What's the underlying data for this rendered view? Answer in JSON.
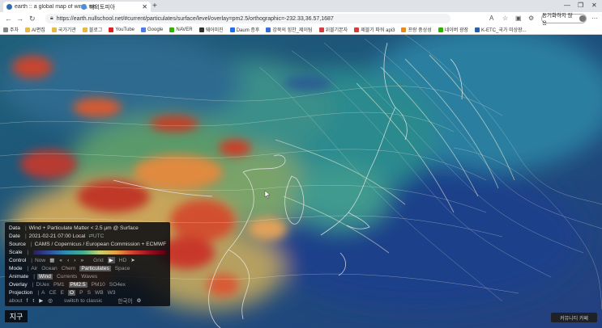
{
  "browser": {
    "tabs": [
      {
        "title": "earth :: a global map of wind, we",
        "active": true
      },
      {
        "title": "해외토피아",
        "active": false
      }
    ],
    "new_tab": "+",
    "url": "https://earth.nullschool.net/#current/particulates/surface/level/overlay=pm2.5/orthographic=-232.33,36.57,1687",
    "sync_label": "동기화하지 않음",
    "bookmarks": [
      "주차",
      "AI편집",
      "국가기관",
      "블로그",
      "YouTube",
      "Google",
      "NAVER",
      "웨어미진",
      "Daum 증후",
      "강북의 힘찬_제이팀",
      "위블기본자",
      "제블기 파워 api3",
      "프랑 중상성",
      "네이버 광장",
      "K-ETC_국가 미상장..."
    ]
  },
  "panel": {
    "data_key": "Data",
    "data_value": "Wind + Particulate Matter < 2.5 µm @ Surface",
    "date_key": "Date",
    "date_value": "2021-02-21 07:00 Local",
    "date_alt": "⇄UTC",
    "source_key": "Source",
    "source_value": "CAMS / Copernicus / European Commission + ECMWF",
    "scale_key": "Scale",
    "control_key": "Control",
    "control_now": "Now",
    "control_grid": "Grid",
    "control_hd": "HD",
    "mode_key": "Mode",
    "mode_options": [
      "Air",
      "Ocean",
      "Chem",
      "Particulates",
      "Space"
    ],
    "mode_selected": "Particulates",
    "animate_key": "Animate",
    "animate_options": [
      "Wind",
      "Currents",
      "Waves"
    ],
    "animate_selected": "Wind",
    "overlay_key": "Overlay",
    "overlay_options": [
      "DUex",
      "PM1",
      "PM2.5",
      "PM10",
      "SO4ex"
    ],
    "overlay_selected": "PM2.5",
    "projection_key": "Projection",
    "projection_options": [
      "A",
      "CE",
      "E",
      "O",
      "P",
      "S",
      "WB",
      "W3"
    ],
    "projection_selected": "O",
    "about": "about",
    "switch_classic": "switch to classic",
    "language": "한국어"
  },
  "earth_button": "지구",
  "notification": "커뮤니티 카페"
}
